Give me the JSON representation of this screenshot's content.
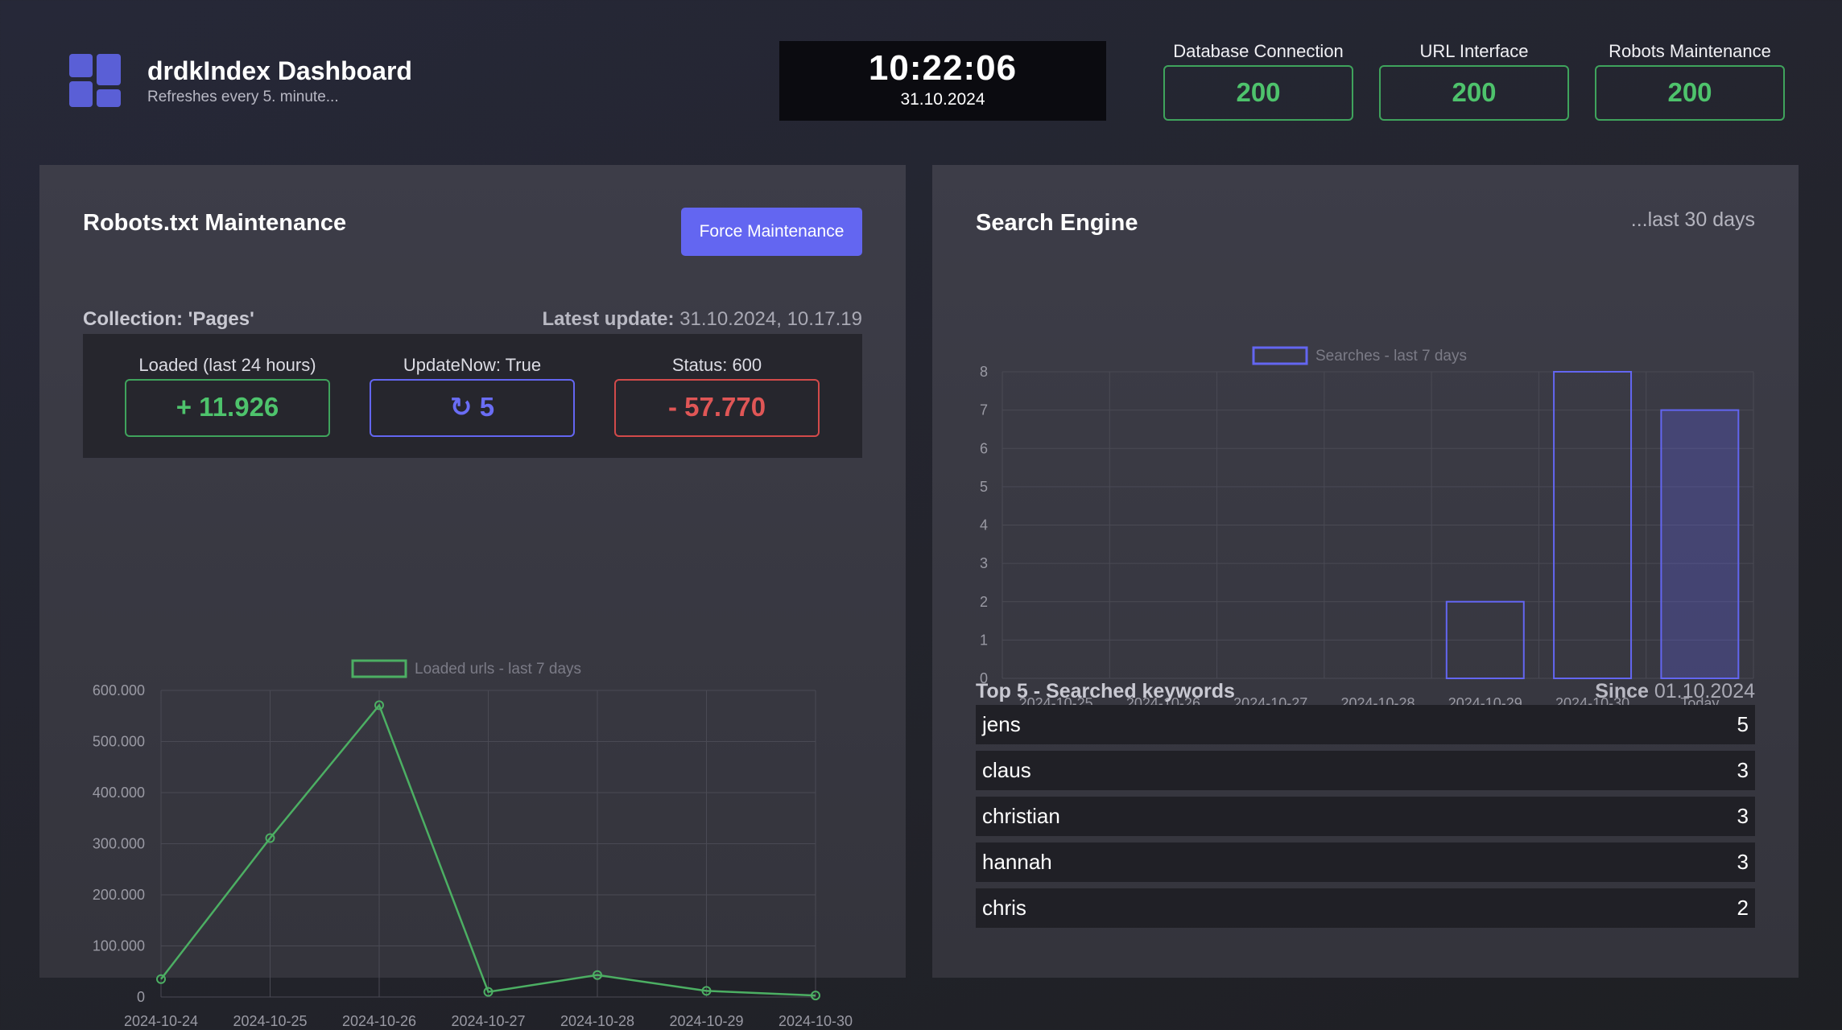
{
  "header": {
    "title": "drdkIndex Dashboard",
    "subtitle": "Refreshes every 5. minute...",
    "clock_time": "10:22:06",
    "clock_date": "31.10.2024",
    "statuses": [
      {
        "label": "Database Connection",
        "value": "200"
      },
      {
        "label": "URL Interface",
        "value": "200"
      },
      {
        "label": "Robots Maintenance",
        "value": "200"
      }
    ]
  },
  "robots": {
    "title": "Robots.txt Maintenance",
    "force_button": "Force Maintenance",
    "collection": "Collection: 'Pages'",
    "latest_label": "Latest update:",
    "latest_value": "31.10.2024, 10.17.19",
    "stats": [
      {
        "label": "Loaded (last 24 hours)",
        "value": "+ 11.926"
      },
      {
        "label": "UpdateNow: True",
        "value": "↻ 5"
      },
      {
        "label": "Status: 600",
        "value": "- 57.770"
      }
    ]
  },
  "search": {
    "title": "Search Engine",
    "range_note": "...last 30 days",
    "keywords_title": "Top 5 - Searched keywords",
    "since_label": "Since",
    "since_value": "01.10.2024",
    "keywords": [
      {
        "word": "jens",
        "count": "5"
      },
      {
        "word": "claus",
        "count": "3"
      },
      {
        "word": "christian",
        "count": "3"
      },
      {
        "word": "hannah",
        "count": "3"
      },
      {
        "word": "chris",
        "count": "2"
      }
    ]
  },
  "colors": {
    "accent": "#6366f1",
    "ok_green": "#4ec36c",
    "error_red": "#e05656",
    "line_green": "#4caf63"
  },
  "chart_data": [
    {
      "type": "line",
      "series": [
        {
          "name": "Loaded urls - last 7 days",
          "values": [
            35000,
            311000,
            571000,
            10000,
            43000,
            12000,
            3000
          ]
        }
      ],
      "categories": [
        "2024-10-24",
        "2024-10-25",
        "2024-10-26",
        "2024-10-27",
        "2024-10-28",
        "2024-10-29",
        "2024-10-30"
      ],
      "yticks": [
        "0",
        "100.000",
        "200.000",
        "300.000",
        "400.000",
        "500.000",
        "600.000"
      ],
      "ylim": [
        0,
        600000
      ],
      "legend": "top-center",
      "grid": true
    },
    {
      "type": "bar",
      "series": [
        {
          "name": "Searches - last 7 days",
          "values": [
            0,
            0,
            0,
            0,
            2,
            8,
            7
          ]
        }
      ],
      "categories": [
        "2024-10-25",
        "2024-10-26",
        "2024-10-27",
        "2024-10-28",
        "2024-10-29",
        "2024-10-30",
        "Today"
      ],
      "yticks": [
        "0",
        "1",
        "2",
        "3",
        "4",
        "5",
        "6",
        "7",
        "8"
      ],
      "ylim": [
        0,
        8
      ],
      "legend": "top-center",
      "grid": true
    }
  ]
}
